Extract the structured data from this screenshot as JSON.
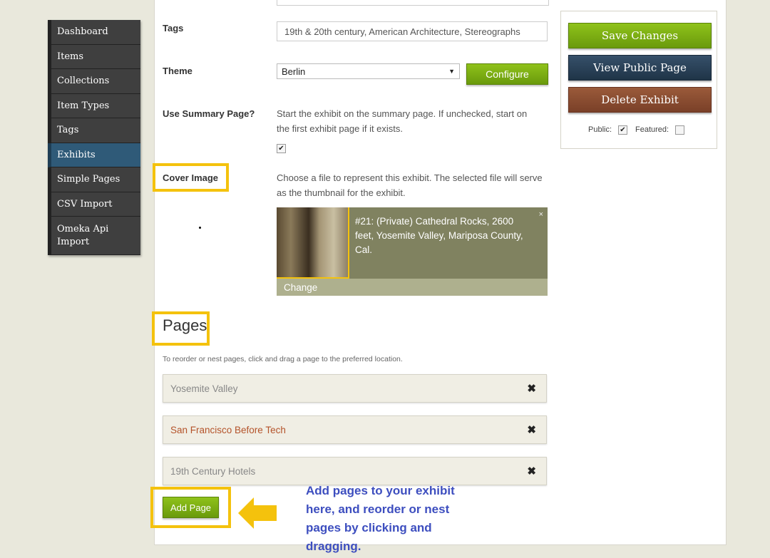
{
  "sidebar": {
    "items": [
      {
        "label": "Dashboard"
      },
      {
        "label": "Items"
      },
      {
        "label": "Collections"
      },
      {
        "label": "Item Types"
      },
      {
        "label": "Tags"
      },
      {
        "label": "Exhibits"
      },
      {
        "label": "Simple Pages"
      },
      {
        "label": "CSV Import"
      },
      {
        "label": "Omeka Api Import"
      }
    ],
    "active": "Exhibits"
  },
  "form": {
    "tags_label": "Tags",
    "tags_value": "19th & 20th century, American Architecture, Stereographs",
    "theme_label": "Theme",
    "theme_value": "Berlin",
    "configure_label": "Configure",
    "summary_label": "Use Summary Page?",
    "summary_help": "Start the exhibit on the summary page. If unchecked, start on the first exhibit page if it exists.",
    "summary_checked": true,
    "cover_label": "Cover Image",
    "cover_help": "Choose a file to represent this exhibit. The selected file will serve as the thumbnail for the exhibit.",
    "cover_title": "#21: (Private) Cathedral Rocks, 2600 feet, Yosemite Valley, Mariposa County, Cal.",
    "cover_change": "Change",
    "cover_close": "×"
  },
  "pages": {
    "heading": "Pages",
    "help": "To reorder or nest pages, click and drag a page to the preferred location.",
    "items": [
      {
        "title": "Yosemite Valley"
      },
      {
        "title": "San Francisco Before Tech"
      },
      {
        "title": "19th Century Hotels"
      }
    ],
    "remove_icon": "✖",
    "add_label": "Add Page"
  },
  "actions": {
    "save": "Save Changes",
    "view": "View Public Page",
    "delete": "Delete Exhibit",
    "public_label": "Public:",
    "public_checked": true,
    "featured_label": "Featured:",
    "featured_checked": false
  },
  "annotation": {
    "text": "Add pages to your exhibit here, and reorder or nest pages by clicking and dragging."
  },
  "colors": {
    "highlight": "#f4c20d",
    "annotation": "#3d4ebf",
    "green": "#7aab12",
    "navy": "#2a4258",
    "brown": "#8a4c30"
  }
}
